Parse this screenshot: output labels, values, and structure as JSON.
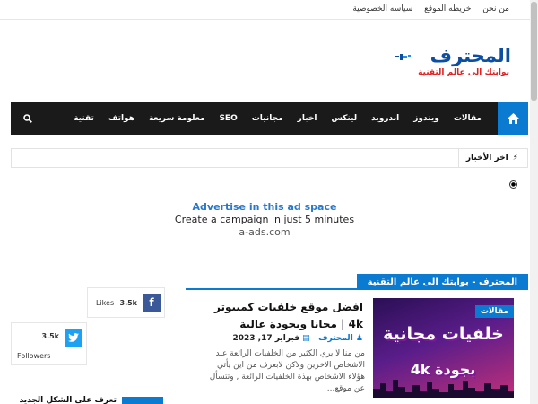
{
  "top_links": [
    "من نحن",
    "خريطه الموقع",
    "سياسه الخصوصية"
  ],
  "logo": {
    "name": "المحترف",
    "tagline": "بوابتك الى عالم التقنية"
  },
  "nav": {
    "items": [
      "مقالات",
      "ويندوز",
      "اندرويد",
      "لينكس",
      "اخبار",
      "مجانيات",
      "SEO",
      "معلومة سريعة",
      "هواتف",
      "تقنية"
    ]
  },
  "ticker": {
    "label": "اخر الأخبار"
  },
  "ad": {
    "line1": "Advertise in this ad space",
    "line2": "Create a campaign in just 5 minutes",
    "line3": "a-ads.com"
  },
  "section": {
    "title": "المحترف - بوابتك الى عالم التقنية"
  },
  "article": {
    "category": "مقالات",
    "thumb_text": "خلفيات مجانية",
    "thumb_text2": "بجودة 4k",
    "title": "افضل موقع خلفيات كمبيوتر 4k | مجانا وبجودة عالية",
    "author": "المحترف",
    "date": "فبراير 17, 2023",
    "excerpt": "من منا لا يري الكثير من الخلفيات الرائعة عند الاشخاص الاخرين ولاكن لابعرف من اين يأتي هؤلاء الاشخاص بهذة الخلفيات الرائعة , وتتسأل عن موقع..."
  },
  "social": {
    "facebook": {
      "count": "3.5k",
      "label": "Likes"
    },
    "twitter": {
      "count": "3.5k",
      "label": "Followers"
    }
  },
  "sidebar": {
    "item_title": "تعرف على الشكل الجديد"
  },
  "colors": {
    "accent": "#0b7ad1",
    "nav_bg": "#1a1a1a",
    "facebook": "#3b5998",
    "twitter": "#1da1f2"
  }
}
